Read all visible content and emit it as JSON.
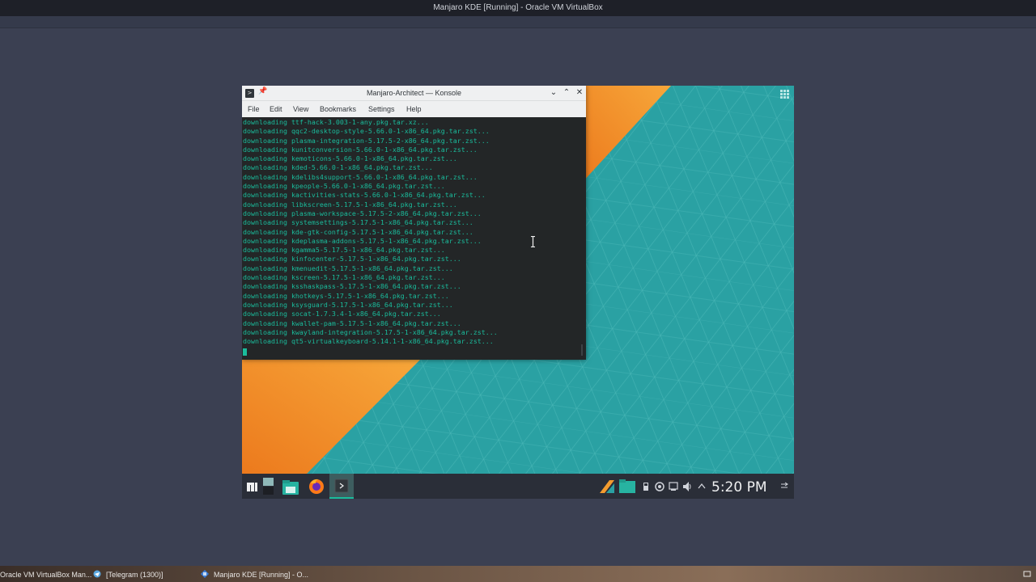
{
  "host": {
    "window_title": "Manjaro KDE [Running] - Oracle VM VirtualBox",
    "taskbar": [
      {
        "label": "Oracle VM VirtualBox Man...",
        "icon": "virtualbox-icon"
      },
      {
        "label": "[Telegram (1300)]",
        "icon": "telegram-icon"
      },
      {
        "label": "Manjaro KDE [Running] - O...",
        "icon": "virtualbox-icon"
      }
    ]
  },
  "konsole": {
    "title": "Manjaro-Architect — Konsole",
    "menu": [
      "File",
      "Edit",
      "View",
      "Bookmarks",
      "Settings",
      "Help"
    ],
    "lines": [
      "downloading ttf-hack-3.003-1-any.pkg.tar.xz...",
      "downloading qqc2-desktop-style-5.66.0-1-x86_64.pkg.tar.zst...",
      "downloading plasma-integration-5.17.5-2-x86_64.pkg.tar.zst...",
      "downloading kunitconversion-5.66.0-1-x86_64.pkg.tar.zst...",
      "downloading kemoticons-5.66.0-1-x86_64.pkg.tar.zst...",
      "downloading kded-5.66.0-1-x86_64.pkg.tar.zst...",
      "downloading kdelibs4support-5.66.0-1-x86_64.pkg.tar.zst...",
      "downloading kpeople-5.66.0-1-x86_64.pkg.tar.zst...",
      "downloading kactivities-stats-5.66.0-1-x86_64.pkg.tar.zst...",
      "downloading libkscreen-5.17.5-1-x86_64.pkg.tar.zst...",
      "downloading plasma-workspace-5.17.5-2-x86_64.pkg.tar.zst...",
      "downloading systemsettings-5.17.5-1-x86_64.pkg.tar.zst...",
      "downloading kde-gtk-config-5.17.5-1-x86_64.pkg.tar.zst...",
      "downloading kdeplasma-addons-5.17.5-1-x86_64.pkg.tar.zst...",
      "downloading kgamma5-5.17.5-1-x86_64.pkg.tar.zst...",
      "downloading kinfocenter-5.17.5-1-x86_64.pkg.tar.zst...",
      "downloading kmenuedit-5.17.5-1-x86_64.pkg.tar.zst...",
      "downloading kscreen-5.17.5-1-x86_64.pkg.tar.zst...",
      "downloading ksshaskpass-5.17.5-1-x86_64.pkg.tar.zst...",
      "downloading khotkeys-5.17.5-1-x86_64.pkg.tar.zst...",
      "downloading ksysguard-5.17.5-1-x86_64.pkg.tar.zst...",
      "downloading socat-1.7.3.4-1-x86_64.pkg.tar.zst...",
      "downloading kwallet-pam-5.17.5-1-x86_64.pkg.tar.zst...",
      "downloading kwayland-integration-5.17.5-1-x86_64.pkg.tar.zst...",
      "downloading qt5-virtualkeyboard-5.14.1-1-x86_64.pkg.tar.zst..."
    ]
  },
  "guest_panel": {
    "clock": "5:20 PM",
    "launchers": [
      "application-menu-icon",
      "pager-icon",
      "file-manager-icon",
      "firefox-icon",
      "konsole-icon"
    ],
    "tray": [
      "manjaro-architect-icon",
      "files-icon",
      "usb-icon",
      "updates-icon",
      "network-icon",
      "volume-icon",
      "expand-tray-icon"
    ]
  },
  "colors": {
    "terminal_text": "#1abc9c",
    "terminal_bg": "#232627",
    "wallpaper_teal": "#2aa1a3",
    "wallpaper_orange": "#f39c2f"
  }
}
